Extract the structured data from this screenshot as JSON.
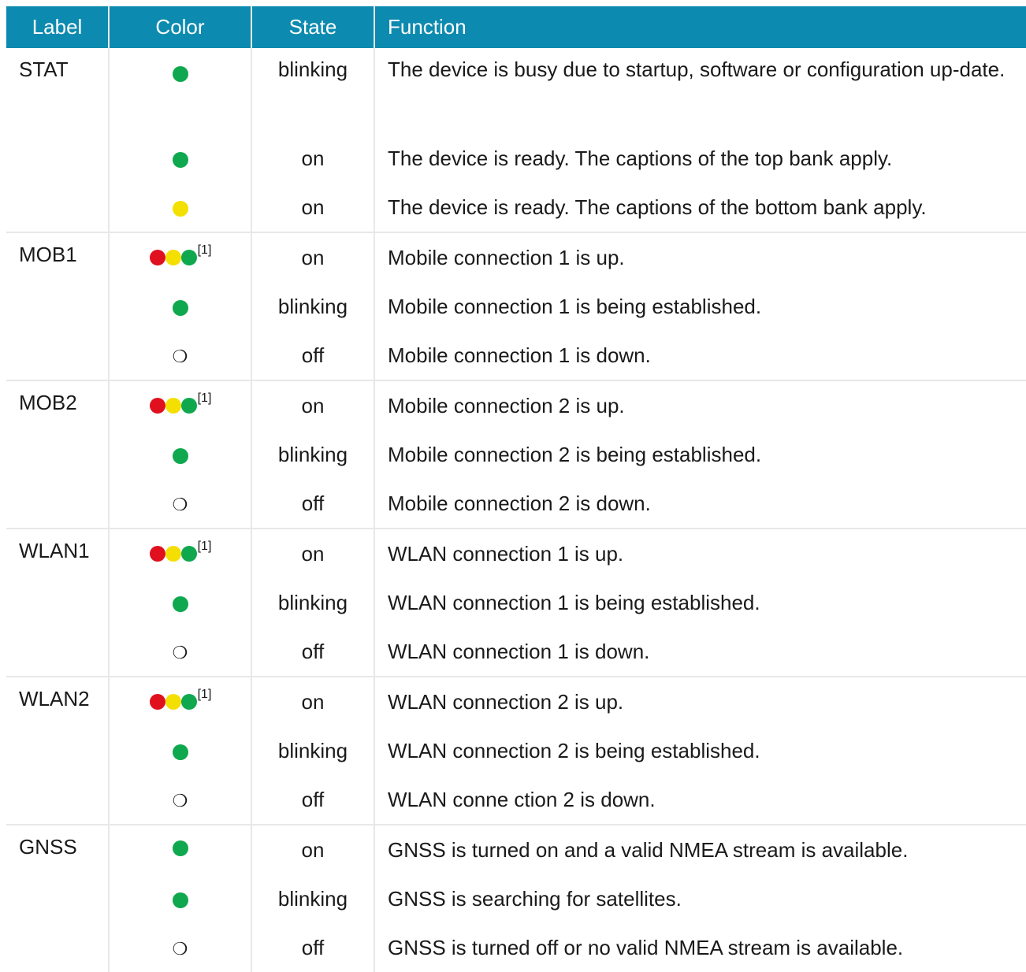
{
  "header": {
    "label": "Label",
    "color": "Color",
    "state": "State",
    "function": "Function"
  },
  "colors": {
    "header_bg": "#0d8aaf",
    "green": "#0fa84f",
    "yellow": "#f4e000",
    "red": "#e0101e",
    "grid": "#e8e8e8"
  },
  "footnote_marker": "[1]",
  "off_symbol": "❍",
  "rows": [
    {
      "label": "STAT",
      "color": "green",
      "state": "blinking",
      "function": "The device is busy due to startup, software or configuration up-date."
    },
    {
      "label": "",
      "color": "green",
      "state": "on",
      "function": "The device is ready. The captions of the top bank apply."
    },
    {
      "label": "",
      "color": "yellow",
      "state": "on",
      "function": "The device is ready. The captions of the bottom bank apply."
    },
    {
      "label": "MOB1",
      "color": "red-yellow-green",
      "state": "on",
      "function": "Mobile connection 1 is up."
    },
    {
      "label": "",
      "color": "green",
      "state": "blinking",
      "function": "Mobile connection 1 is being established."
    },
    {
      "label": "",
      "color": "off",
      "state": "off",
      "function": "Mobile connection 1 is down."
    },
    {
      "label": "MOB2",
      "color": "red-yellow-green",
      "state": "on",
      "function": "Mobile connection 2 is up."
    },
    {
      "label": "",
      "color": "green",
      "state": "blinking",
      "function": "Mobile connection 2 is being established."
    },
    {
      "label": "",
      "color": "off",
      "state": "off",
      "function": "Mobile connection 2 is down."
    },
    {
      "label": "WLAN1",
      "color": "red-yellow-green",
      "state": "on",
      "function": "WLAN connection 1 is up."
    },
    {
      "label": "",
      "color": "green",
      "state": "blinking",
      "function": "WLAN connection 1 is being established."
    },
    {
      "label": "",
      "color": "off",
      "state": "off",
      "function": "WLAN connection 1 is down."
    },
    {
      "label": "WLAN2",
      "color": "red-yellow-green",
      "state": "on",
      "function": "WLAN connection 2 is up."
    },
    {
      "label": "",
      "color": "green",
      "state": "blinking",
      "function": "WLAN connection 2 is being established."
    },
    {
      "label": "",
      "color": "off",
      "state": "off",
      "function": "WLAN conne ction 2 is down."
    },
    {
      "label": "GNSS",
      "color": "green",
      "state": "on",
      "function": "GNSS is turned on and a valid NMEA stream is available."
    },
    {
      "label": "",
      "color": "green",
      "state": "blinking",
      "function": "GNSS is searching for satellites."
    },
    {
      "label": "",
      "color": "off",
      "state": "off",
      "function": "GNSS is turned off or no valid NMEA stream is available."
    }
  ]
}
